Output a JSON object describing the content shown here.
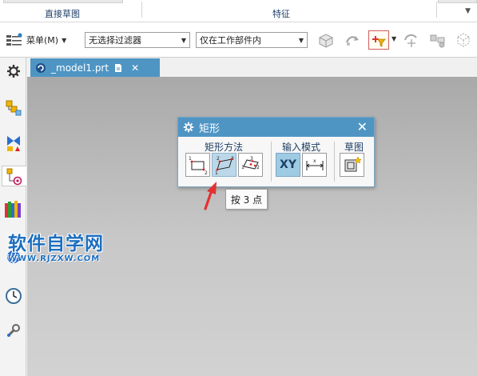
{
  "ribbon": {
    "group_direct_sketch": "直接草图",
    "group_feature": "特征"
  },
  "toolbar": {
    "menu_label": "菜单(M)",
    "filter_value": "无选择过滤器",
    "scope_value": "仅在工作部件内"
  },
  "tabs": [
    {
      "label": "_model1.prt"
    }
  ],
  "dialog": {
    "title": "矩形",
    "groups": {
      "method": "矩形方法",
      "input_mode": "输入模式",
      "sketch": "草图"
    },
    "xy_label": "XY"
  },
  "tooltip": "按 3 点",
  "watermark": {
    "name": "软件自学网",
    "url": "WWW.RJZXW.COM"
  },
  "colors": {
    "accent": "#4e95c4",
    "arrow": "#e53030"
  },
  "icons": {
    "dialog": "gear-icon",
    "close": "close-icon"
  }
}
